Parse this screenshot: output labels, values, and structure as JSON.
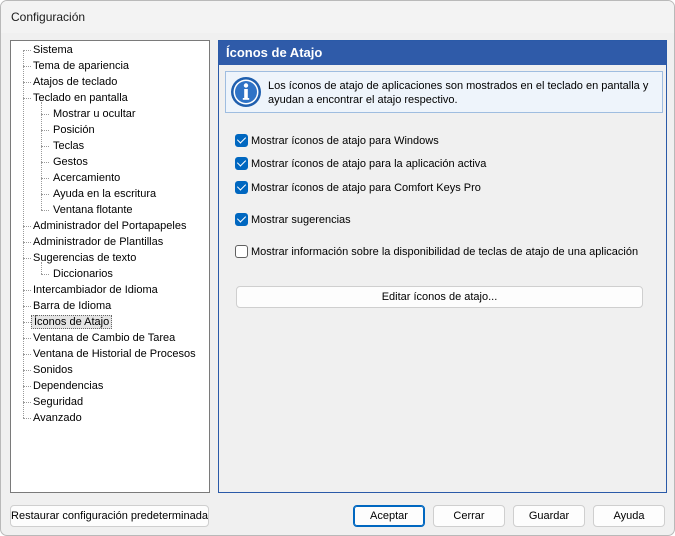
{
  "window": {
    "title": "Configuración"
  },
  "tree": {
    "items": [
      {
        "label": "Sistema",
        "level": 0
      },
      {
        "label": "Tema de apariencia",
        "level": 0
      },
      {
        "label": "Atajos de teclado",
        "level": 0
      },
      {
        "label": "Teclado en pantalla",
        "level": 0
      },
      {
        "label": "Mostrar u ocultar",
        "level": 1
      },
      {
        "label": "Posición",
        "level": 1
      },
      {
        "label": "Teclas",
        "level": 1
      },
      {
        "label": "Gestos",
        "level": 1
      },
      {
        "label": "Acercamiento",
        "level": 1
      },
      {
        "label": "Ayuda en la escritura",
        "level": 1
      },
      {
        "label": "Ventana flotante",
        "level": 1
      },
      {
        "label": "Administrador del Portapapeles",
        "level": 0
      },
      {
        "label": "Administrador de Plantillas",
        "level": 0
      },
      {
        "label": "Sugerencias de texto",
        "level": 0
      },
      {
        "label": "Diccionarios",
        "level": 1
      },
      {
        "label": "Intercambiador de Idioma",
        "level": 0
      },
      {
        "label": "Barra de Idioma",
        "level": 0
      },
      {
        "label": "Íconos de Atajo",
        "level": 0,
        "selected": true
      },
      {
        "label": "Ventana de Cambio de Tarea",
        "level": 0
      },
      {
        "label": "Ventana de Historial de Procesos",
        "level": 0
      },
      {
        "label": "Sonidos",
        "level": 0
      },
      {
        "label": "Dependencias",
        "level": 0
      },
      {
        "label": "Seguridad",
        "level": 0
      },
      {
        "label": "Avanzado",
        "level": 0
      }
    ]
  },
  "panel": {
    "title": "Íconos de Atajo",
    "info_text": "Los íconos de atajo de aplicaciones son mostrados en el teclado en pantalla y ayudan a encontrar el atajo respectivo.",
    "options": [
      {
        "label": "Mostrar íconos de atajo para Windows",
        "checked": true
      },
      {
        "label": "Mostrar íconos de atajo para la aplicación activa",
        "checked": true
      },
      {
        "label": "Mostrar íconos de atajo para Comfort Keys Pro",
        "checked": true
      },
      {
        "label": "Mostrar sugerencias",
        "checked": true
      },
      {
        "label": "Mostrar información sobre la disponibilidad de teclas de atajo de una aplicación",
        "checked": false
      }
    ],
    "edit_button": "Editar íconos de atajo..."
  },
  "footer": {
    "restore": "Restaurar configuración predeterminada",
    "accept": "Aceptar",
    "close": "Cerrar",
    "save": "Guardar",
    "help": "Ayuda"
  },
  "colors": {
    "accent": "#2f5ba9",
    "check": "#0067c0"
  }
}
